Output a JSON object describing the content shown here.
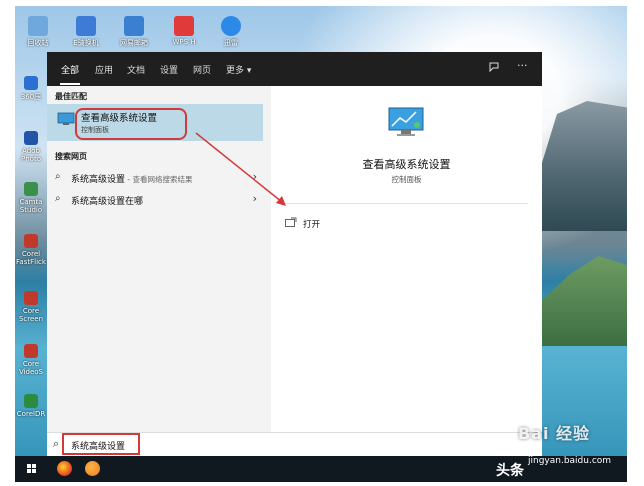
{
  "desktop": {
    "icons": [
      {
        "label": "回收站",
        "color": "#6fa8dc"
      },
      {
        "label": "E骑换机",
        "color": "#3d7bd6"
      },
      {
        "label": "网易邮箱",
        "color": "#3b7fd1"
      },
      {
        "label": "WPS H",
        "color": "#e03a3a"
      },
      {
        "label": "迅雷",
        "color": "#2c89e8"
      }
    ],
    "left_icons": [
      {
        "label": "360压",
        "color": "#2b6fd0"
      },
      {
        "label": "Adob Photo",
        "color": "#2255aa"
      },
      {
        "label": "Camta Studio",
        "color": "#3a8f4a"
      },
      {
        "label": "Corel FastFlick",
        "color": "#c0392b"
      },
      {
        "label": "Core Screen",
        "color": "#c0392b"
      },
      {
        "label": "Core VideoS",
        "color": "#c0392b"
      },
      {
        "label": "CorelDR",
        "color": "#2c8b3e"
      }
    ]
  },
  "topbar": {
    "tabs": [
      "全部",
      "应用",
      "文档",
      "设置",
      "网页",
      "更多 ▾"
    ],
    "feedback_icon": "feedback-icon",
    "more_icon": "ellipsis-icon"
  },
  "results": {
    "best_match_heading": "最佳匹配",
    "best_match": {
      "title": "查看高级系统设置",
      "subtitle": "控制面板",
      "icon": "monitor-icon"
    },
    "web_heading": "搜索网页",
    "web_items": [
      {
        "text": "系统高级设置",
        "hint": " - 查看网络搜索结果"
      },
      {
        "text": "系统高级设置在哪",
        "hint": ""
      }
    ]
  },
  "detail": {
    "title": "查看高级系统设置",
    "subtitle": "控制面板",
    "open_label": "打开"
  },
  "search": {
    "value": "系统高级设置"
  },
  "watermark": {
    "text": "Bai 经验",
    "url": "jingyan.baidu.com",
    "big": "头条"
  },
  "colors": {
    "accent_red": "#d23a3a",
    "highlight": "#bcd9e8",
    "topbar": "#1f1f1f"
  }
}
